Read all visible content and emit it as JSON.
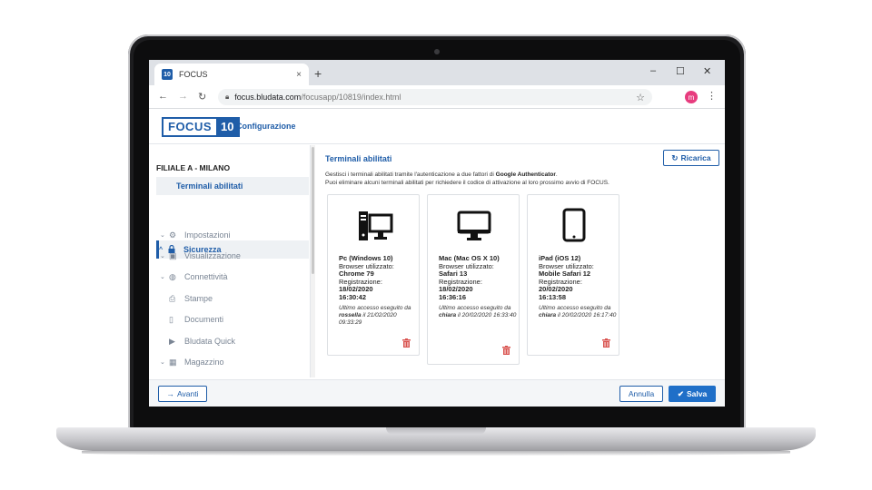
{
  "browser": {
    "tab_title": "FOCUS",
    "tab_favicon": "10",
    "tab_close": "×",
    "new_tab": "+",
    "window_min": "–",
    "window_max": "☐",
    "window_close": "✕",
    "url_main": "focus.bludata.com",
    "url_path": "/focusapp/10819/index.html",
    "profile_initial": "m"
  },
  "app": {
    "logo_text": "FOCUS",
    "logo_number": "10",
    "section_title": "Configurazione"
  },
  "sidebar": {
    "branch": "FILIALE A - MILANO",
    "items": [
      {
        "label": "Sicurezza",
        "icon": "lock-icon"
      },
      {
        "label": "Terminali abilitati"
      },
      {
        "label": "Impostazioni",
        "icon": "gears-icon"
      },
      {
        "label": "Visualizzazione",
        "icon": "windows-icon"
      },
      {
        "label": "Connettività",
        "icon": "globe-icon"
      },
      {
        "label": "Stampe",
        "icon": "printer-icon"
      },
      {
        "label": "Documenti",
        "icon": "document-icon"
      },
      {
        "label": "Bludata Quick",
        "icon": "play-icon"
      },
      {
        "label": "Magazzino",
        "icon": "warehouse-icon"
      }
    ]
  },
  "main": {
    "title": "Terminali abilitati",
    "reload_label": "Ricarica",
    "desc_line1_pre": "Gestisci i terminali abilitati tramite l'autenticazione a due fattori di ",
    "desc_line1_bold": "Google Authenticator",
    "desc_line1_post": ".",
    "desc_line2": "Puoi eliminare alcuni terminali abilitati per richiedere il codice di attivazione al loro prossimo avvio di FOCUS.",
    "browser_label": "Browser utilizzato:",
    "registration_label": "Registrazione:",
    "last_access_pre": "Ultimo accesso eseguito da ",
    "last_access_mid": "il ",
    "devices": [
      {
        "icon": "desktop-pc-icon",
        "name": "Pc (Windows 10)",
        "browser": "Chrome 79",
        "reg_date": "18/02/2020",
        "reg_time": "16:30:42",
        "user": "rossella",
        "access": "21/02/2020 09:33:29"
      },
      {
        "icon": "mac-monitor-icon",
        "name": "Mac (Mac OS X 10)",
        "browser": "Safari 13",
        "reg_date": "18/02/2020",
        "reg_time": "16:36:16",
        "user": "chiara",
        "access": "20/02/2020 16:33:40"
      },
      {
        "icon": "tablet-icon",
        "name": "iPad (iOS 12)",
        "browser": "Mobile Safari 12",
        "reg_date": "20/02/2020",
        "reg_time": "16:13:58",
        "user": "chiara",
        "access": "20/02/2020 16:17:40"
      }
    ]
  },
  "footer": {
    "next_label": "Avanti",
    "cancel_label": "Annulla",
    "save_label": "Salva"
  },
  "colors": {
    "accent": "#1f5da8",
    "primary_button": "#1f6fc8",
    "danger": "#d9534f"
  }
}
